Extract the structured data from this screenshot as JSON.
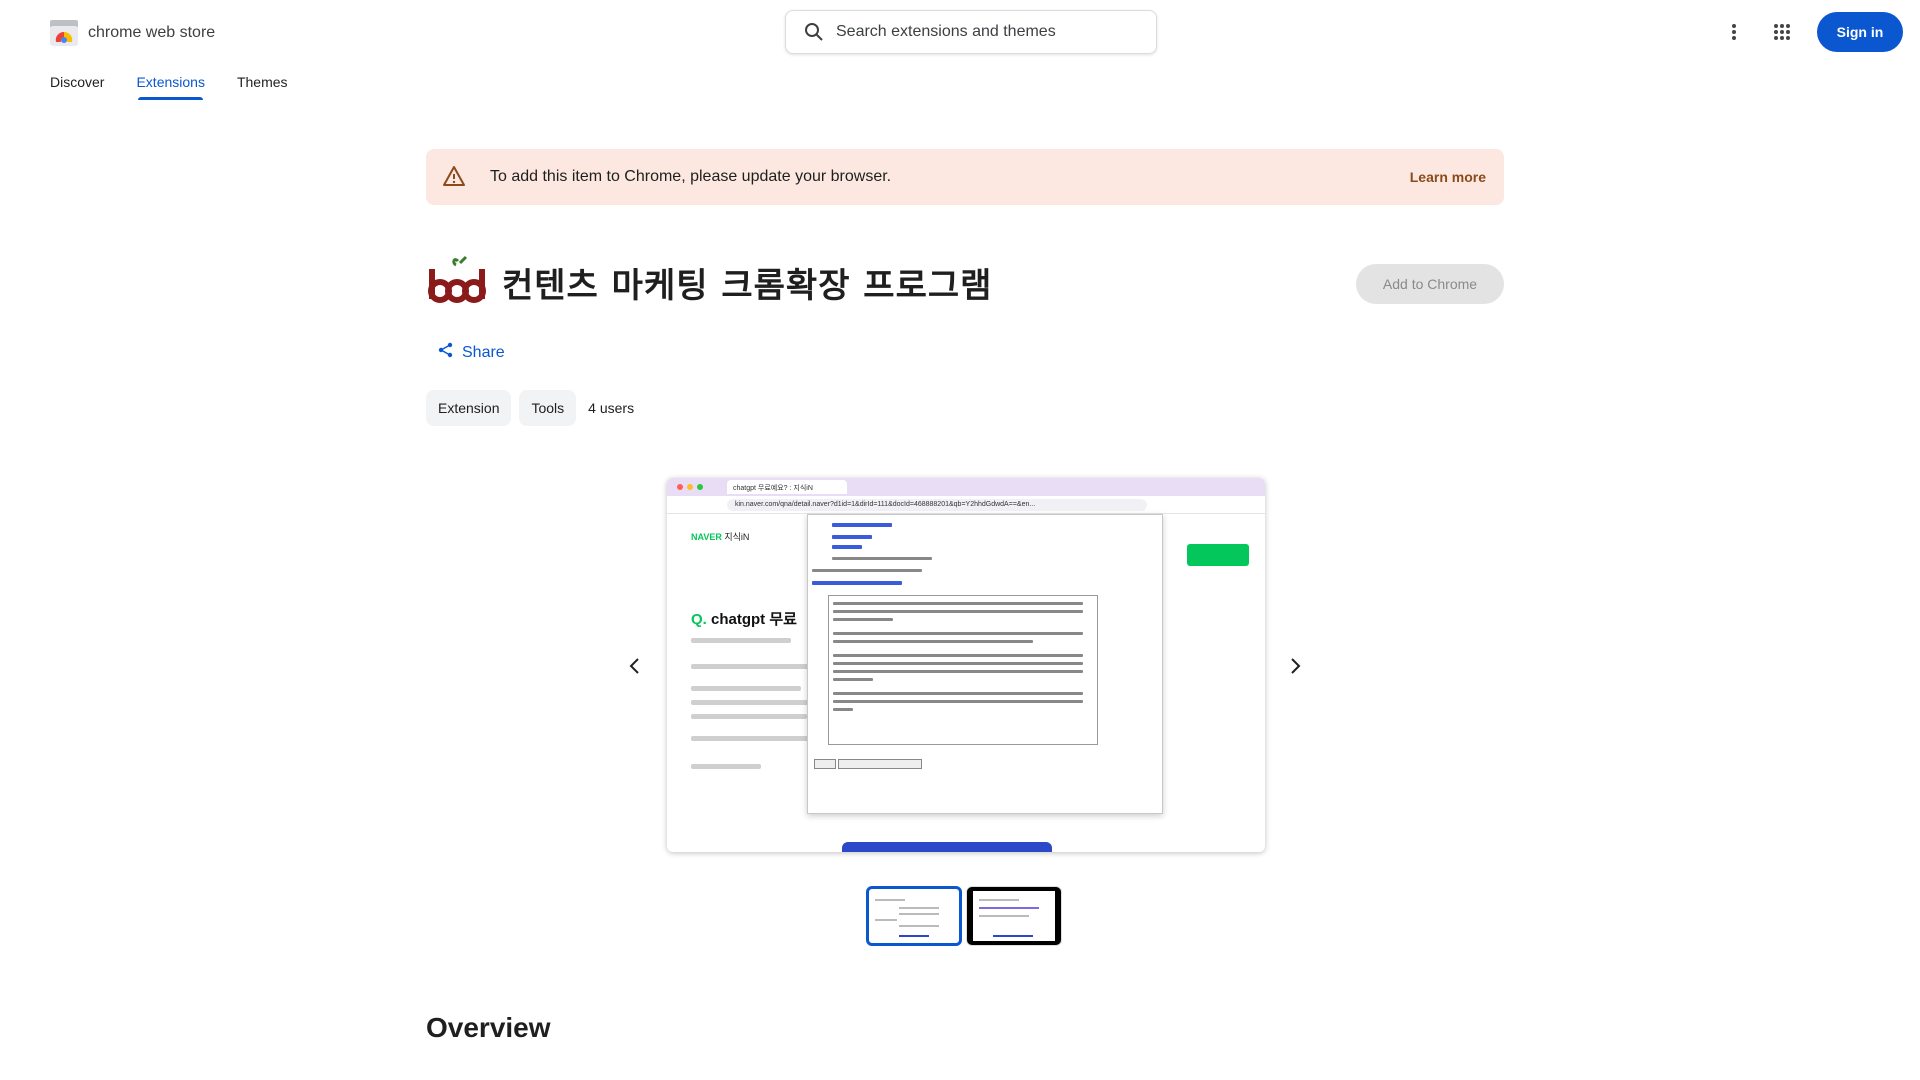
{
  "header": {
    "store_name": "chrome web store",
    "search_placeholder": "Search extensions and themes",
    "more_icon": "more-vert-icon",
    "apps_icon": "apps-grid-icon",
    "signin_label": "Sign in"
  },
  "nav": {
    "tabs": [
      {
        "label": "Discover",
        "active": false
      },
      {
        "label": "Extensions",
        "active": true
      },
      {
        "label": "Themes",
        "active": false
      }
    ]
  },
  "banner": {
    "message": "To add this item to Chrome, please update your browser.",
    "link": "Learn more",
    "icon": "warning-icon"
  },
  "extension": {
    "title": "컨텐츠 마케팅 크롬확장 프로그램",
    "add_button": "Add to Chrome",
    "share_label": "Share",
    "chips": [
      "Extension",
      "Tools"
    ],
    "users": "4 users"
  },
  "carousel": {
    "prev_icon": "chevron-left-icon",
    "next_icon": "chevron-right-icon",
    "thumbnail_count": 2,
    "active_index": 0,
    "screenshot": {
      "tab_title": "chatgpt 무료예요? : 지식iN",
      "url": "kin.naver.com/qna/detail.naver?d1id=1&dirId=111&docId=468888201&qb=Y2hhdGdwdA==&en...",
      "brand": "NAVER",
      "brand_sub": "지식iN",
      "question_prefix": "Q.",
      "question": "chatgpt 무료"
    }
  },
  "overview_heading": "Overview",
  "colors": {
    "accent": "#0b57d0",
    "banner_bg": "#fce8e0",
    "banner_link": "#8c4a1c",
    "naver_green": "#03c75a"
  }
}
